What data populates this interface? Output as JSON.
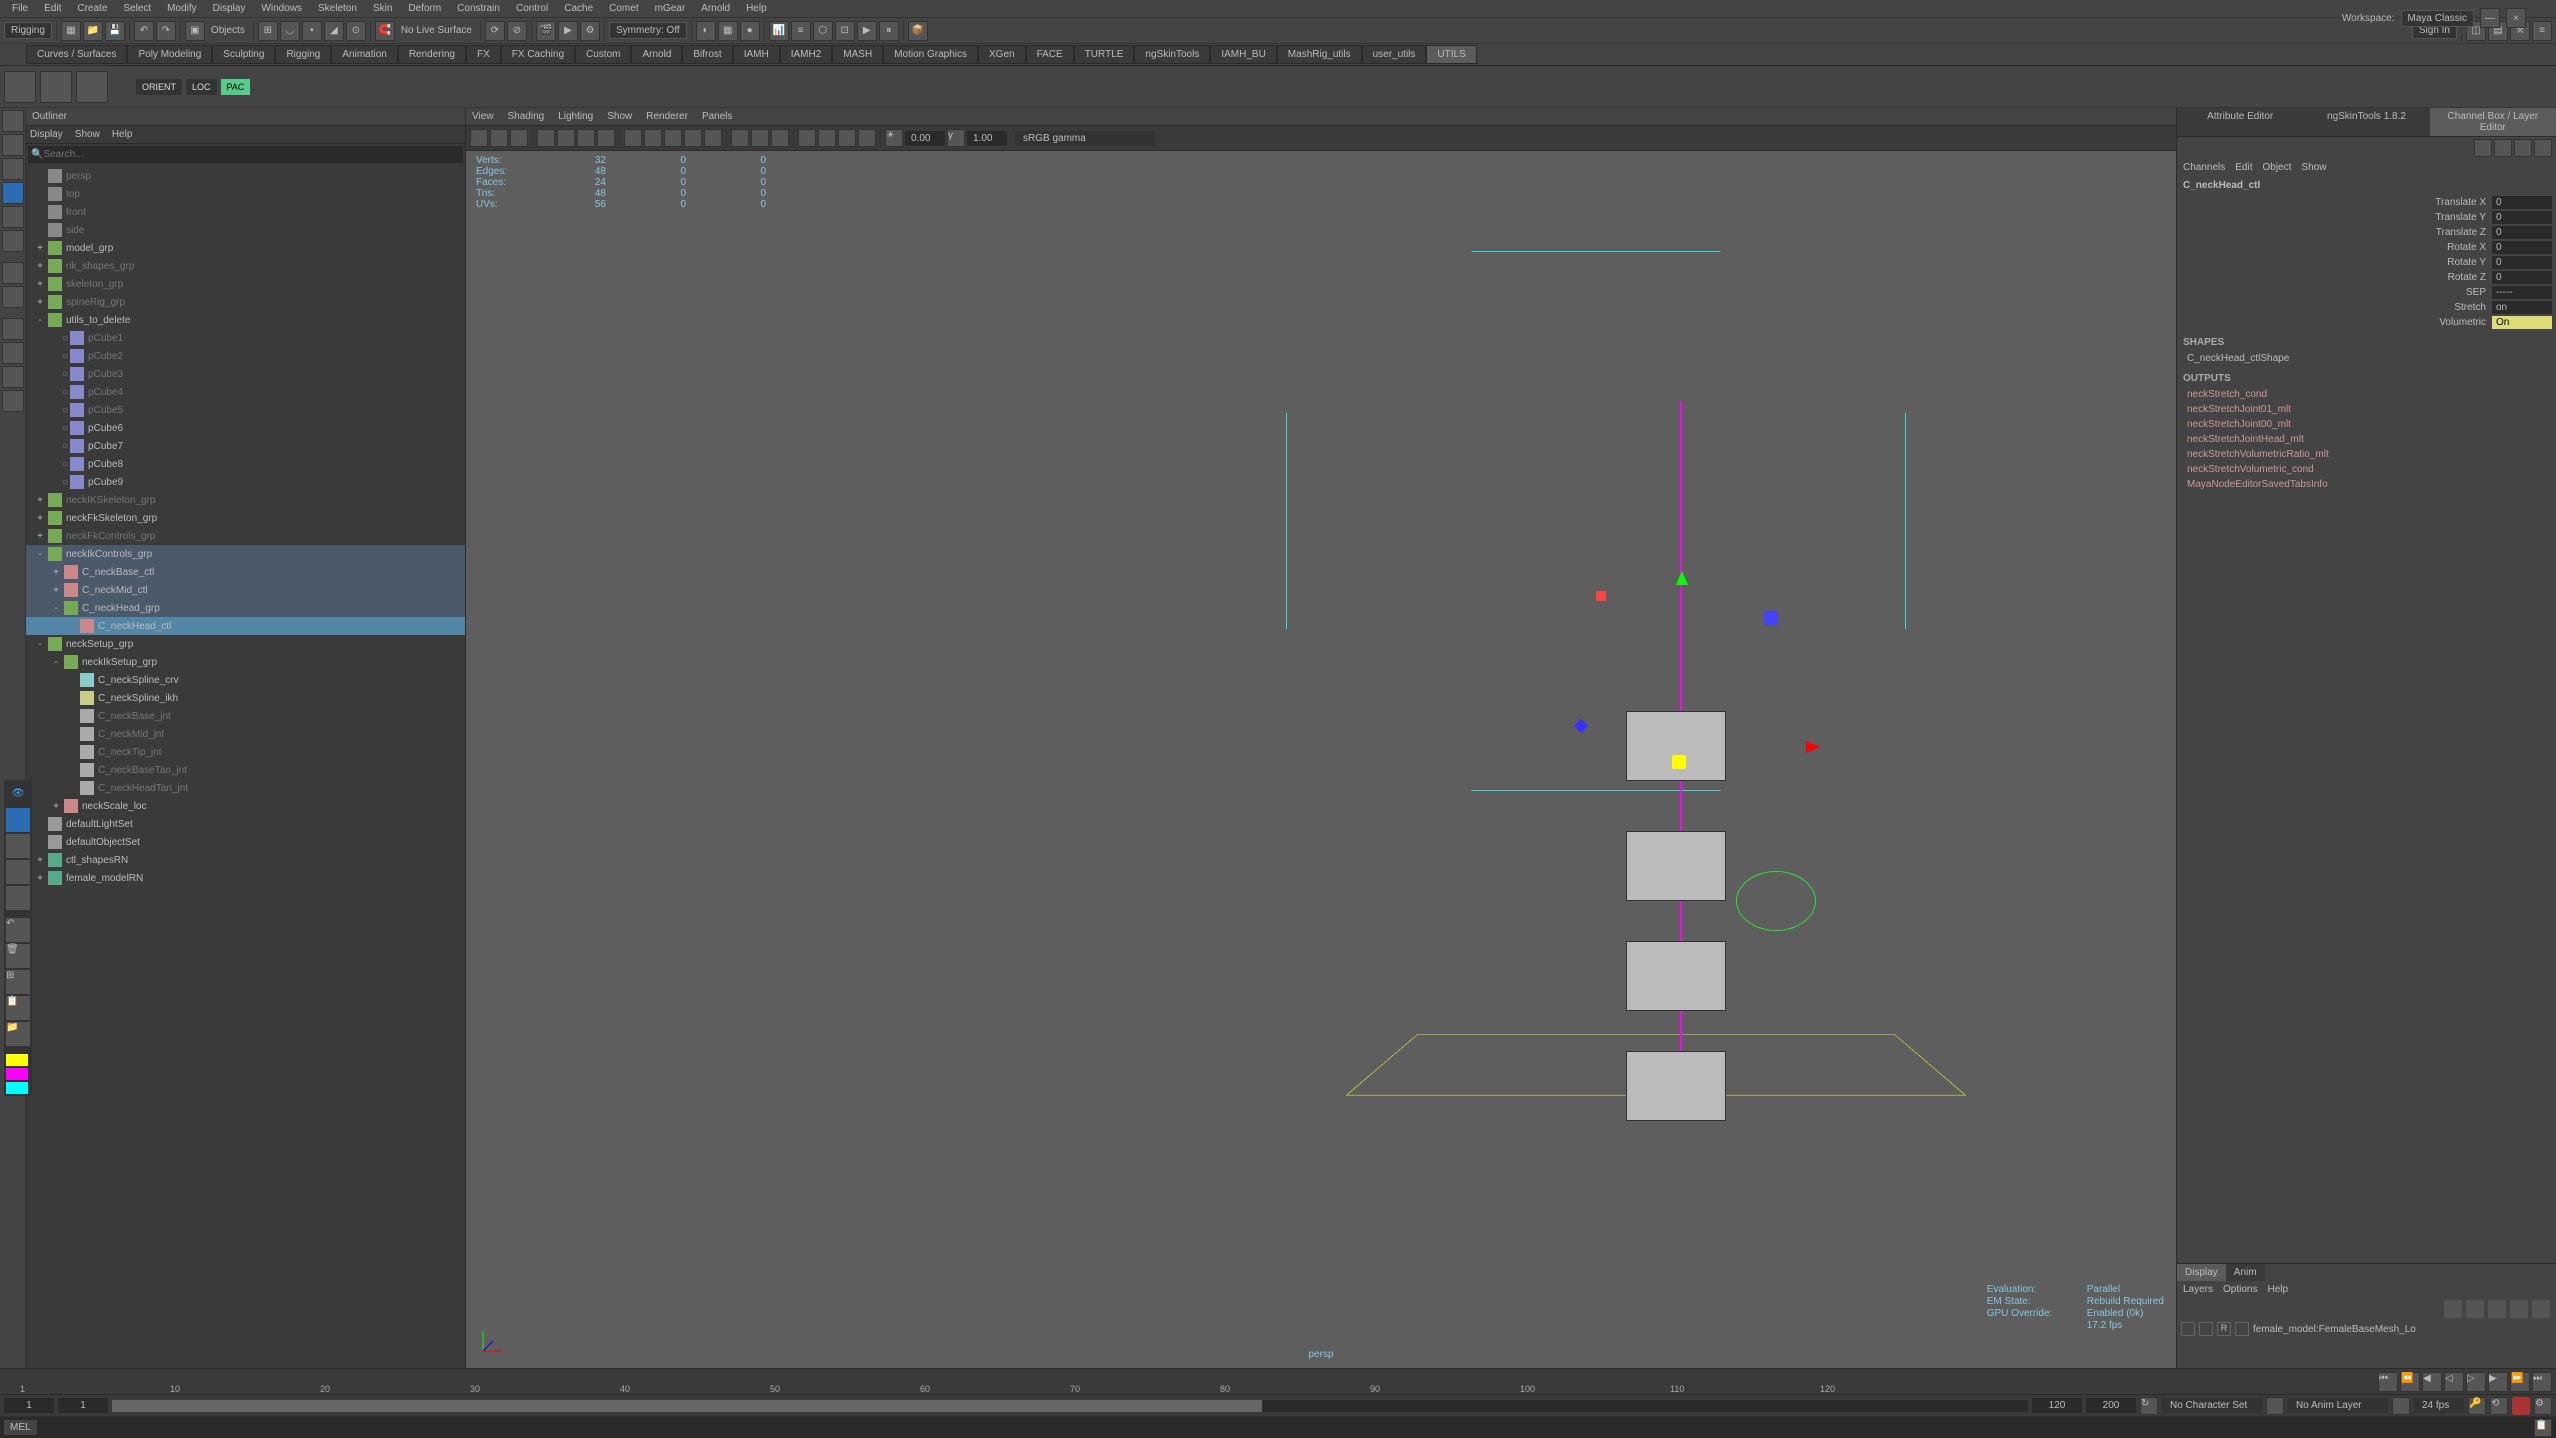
{
  "workspace": {
    "label": "Workspace:",
    "value": "Maya Classic"
  },
  "menubar": [
    "File",
    "Edit",
    "Create",
    "Select",
    "Modify",
    "Display",
    "Windows",
    "Skeleton",
    "Skin",
    "Deform",
    "Constrain",
    "Control",
    "Cache",
    "Comet",
    "mGear",
    "Arnold",
    "Help"
  ],
  "mode_dropdown": "Rigging",
  "status_text": "Objects",
  "status_text2": "No Live Surface",
  "symmetry": "Symmetry: Off",
  "signin": "Sign In",
  "shelf_tabs": [
    "Curves / Surfaces",
    "Poly Modeling",
    "Sculpting",
    "Rigging",
    "Animation",
    "Rendering",
    "FX",
    "FX Caching",
    "Custom",
    "Arnold",
    "Bifrost",
    "IAMH",
    "IAMH2",
    "MASH",
    "Motion Graphics",
    "XGen",
    "FACE",
    "TURTLE",
    "ngSkinTools",
    "IAMH_BU",
    "MashRig_utils",
    "user_utils",
    "UTILS"
  ],
  "shelf_active": "UTILS",
  "orient_buttons": [
    "ORIENT",
    "LOC",
    "PAC"
  ],
  "outliner": {
    "title": "Outliner",
    "menu": [
      "Display",
      "Show",
      "Help"
    ],
    "search_placeholder": "Search...",
    "tree": [
      {
        "label": "persp",
        "depth": 0,
        "dim": true,
        "icon": "camera"
      },
      {
        "label": "top",
        "depth": 0,
        "dim": true,
        "icon": "camera"
      },
      {
        "label": "front",
        "depth": 0,
        "dim": true,
        "icon": "camera"
      },
      {
        "label": "side",
        "depth": 0,
        "dim": true,
        "icon": "camera"
      },
      {
        "label": "model_grp",
        "depth": 0,
        "expand": "+",
        "icon": "group"
      },
      {
        "label": "rik_shapes_grp",
        "depth": 0,
        "dim": true,
        "expand": "+",
        "icon": "group"
      },
      {
        "label": "skeleton_grp",
        "depth": 0,
        "dim": true,
        "expand": "+",
        "icon": "group"
      },
      {
        "label": "spineRig_grp",
        "depth": 0,
        "dim": true,
        "expand": "+",
        "icon": "group"
      },
      {
        "label": "utils_to_delete",
        "depth": 0,
        "expand": "-",
        "icon": "group"
      },
      {
        "label": "pCube1",
        "depth": 1,
        "dim": true,
        "icon": "mesh",
        "vis": "o"
      },
      {
        "label": "pCube2",
        "depth": 1,
        "dim": true,
        "icon": "mesh",
        "vis": "o"
      },
      {
        "label": "pCube3",
        "depth": 1,
        "dim": true,
        "icon": "mesh",
        "vis": "o"
      },
      {
        "label": "pCube4",
        "depth": 1,
        "dim": true,
        "icon": "mesh",
        "vis": "o"
      },
      {
        "label": "pCube5",
        "depth": 1,
        "dim": true,
        "icon": "mesh",
        "vis": "o"
      },
      {
        "label": "pCube6",
        "depth": 1,
        "icon": "mesh",
        "vis": "o"
      },
      {
        "label": "pCube7",
        "depth": 1,
        "icon": "mesh",
        "vis": "o"
      },
      {
        "label": "pCube8",
        "depth": 1,
        "icon": "mesh",
        "vis": "o"
      },
      {
        "label": "pCube9",
        "depth": 1,
        "icon": "mesh",
        "vis": "o"
      },
      {
        "label": "neckIKSkeleton_grp",
        "depth": 0,
        "dim": true,
        "expand": "+",
        "icon": "group"
      },
      {
        "label": "neckFkSkeleton_grp",
        "depth": 0,
        "expand": "+",
        "icon": "group"
      },
      {
        "label": "neckFkControls_grp",
        "depth": 0,
        "dim": true,
        "expand": "+",
        "icon": "group"
      },
      {
        "label": "neckIkControls_grp",
        "depth": 0,
        "expand": "-",
        "icon": "group",
        "sel": "semi"
      },
      {
        "label": "C_neckBase_ctl",
        "depth": 1,
        "expand": "+",
        "icon": "locator",
        "sel": "semi"
      },
      {
        "label": "C_neckMid_ctl",
        "depth": 1,
        "expand": "+",
        "icon": "locator",
        "sel": "semi"
      },
      {
        "label": "C_neckHead_grp",
        "depth": 1,
        "expand": "-",
        "icon": "group",
        "sel": "semi"
      },
      {
        "label": "C_neckHead_ctl",
        "depth": 2,
        "icon": "locator",
        "sel": "full"
      },
      {
        "label": "neckSetup_grp",
        "depth": 0,
        "expand": "-",
        "icon": "group"
      },
      {
        "label": "neckIkSetup_grp",
        "depth": 1,
        "expand": "-",
        "icon": "group"
      },
      {
        "label": "C_neckSpline_crv",
        "depth": 2,
        "icon": "curve"
      },
      {
        "label": "C_neckSpline_ikh",
        "depth": 2,
        "icon": "ik"
      },
      {
        "label": "C_neckBase_jnt",
        "depth": 2,
        "dim": true,
        "icon": "joint"
      },
      {
        "label": "C_neckMid_jnt",
        "depth": 2,
        "dim": true,
        "icon": "joint"
      },
      {
        "label": "C_neckTip_jnt",
        "depth": 2,
        "dim": true,
        "icon": "joint"
      },
      {
        "label": "C_neckBaseTan_jnt",
        "depth": 2,
        "dim": true,
        "icon": "joint"
      },
      {
        "label": "C_neckHeadTan_jnt",
        "depth": 2,
        "dim": true,
        "icon": "joint"
      },
      {
        "label": "neckScale_loc",
        "depth": 1,
        "icon": "locator",
        "expand": "+"
      },
      {
        "label": "defaultLightSet",
        "depth": 0,
        "icon": "set"
      },
      {
        "label": "defaultObjectSet",
        "depth": 0,
        "icon": "set"
      },
      {
        "label": "ctl_shapesRN",
        "depth": 0,
        "icon": "ref",
        "expand": "+"
      },
      {
        "label": "female_modelRN",
        "depth": 0,
        "icon": "ref",
        "expand": "+"
      }
    ]
  },
  "viewport": {
    "menu": [
      "View",
      "Shading",
      "Lighting",
      "Show",
      "Renderer",
      "Panels"
    ],
    "colorspace": "sRGB gamma",
    "gamma": "1.00",
    "exposure": "0.00",
    "hud": {
      "rows": [
        {
          "label": "Verts:",
          "a": "32",
          "b": "0",
          "c": "0"
        },
        {
          "label": "Edges:",
          "a": "48",
          "b": "0",
          "c": "0"
        },
        {
          "label": "Faces:",
          "a": "24",
          "b": "0",
          "c": "0"
        },
        {
          "label": "Tris:",
          "a": "48",
          "b": "0",
          "c": "0"
        },
        {
          "label": "UVs:",
          "a": "56",
          "b": "0",
          "c": "0"
        }
      ],
      "status": [
        {
          "k": "Evaluation:",
          "v": "Parallel"
        },
        {
          "k": "EM State:",
          "v": "Rebuild Required"
        },
        {
          "k": "GPU Override:",
          "v": "Enabled (0k)"
        },
        {
          "k": "",
          "v": "17.2 fps"
        }
      ],
      "camera": "persp"
    }
  },
  "channelbox": {
    "tabs": [
      "Attribute Editor",
      "ngSkinTools 1.8.2",
      "Channel Box / Layer Editor"
    ],
    "menu": [
      "Channels",
      "Edit",
      "Object",
      "Show"
    ],
    "object": "C_neckHead_ctl",
    "channels": [
      {
        "label": "Translate X",
        "val": "0"
      },
      {
        "label": "Translate Y",
        "val": "0"
      },
      {
        "label": "Translate Z",
        "val": "0"
      },
      {
        "label": "Rotate X",
        "val": "0"
      },
      {
        "label": "Rotate Y",
        "val": "0"
      },
      {
        "label": "Rotate Z",
        "val": "0"
      },
      {
        "label": "SEP",
        "val": "-----"
      },
      {
        "label": "Stretch",
        "val": "on"
      },
      {
        "label": "Volumetric",
        "val": "On",
        "on": true
      }
    ],
    "shapes_head": "SHAPES",
    "shape": "C_neckHead_ctlShape",
    "outputs_head": "OUTPUTS",
    "outputs": [
      "neckStretch_cond",
      "neckStretchJoint01_mlt",
      "neckStretchJoint00_mlt",
      "neckStretchJointHead_mlt",
      "neckStretchVolumetricRatio_mlt",
      "neckStretchVolumetric_cond",
      "MayaNodeEditorSavedTabsInfo"
    ]
  },
  "layers": {
    "tabs": [
      "Display",
      "Anim"
    ],
    "menu": [
      "Layers",
      "Options",
      "Help"
    ],
    "row": {
      "vis": "",
      "r": "R",
      "name": "female_model:FemaleBaseMesh_Lo"
    }
  },
  "timeline": {
    "ticks": [
      1,
      10,
      20,
      30,
      40,
      50,
      60,
      70,
      80,
      90,
      100,
      110,
      120
    ],
    "range": {
      "start": "1",
      "end": "120",
      "min": "1",
      "max": "200"
    },
    "char_set": "No Character Set",
    "anim_layer": "No Anim Layer",
    "fps": "24 fps"
  },
  "cmdline": {
    "mel": "MEL"
  }
}
